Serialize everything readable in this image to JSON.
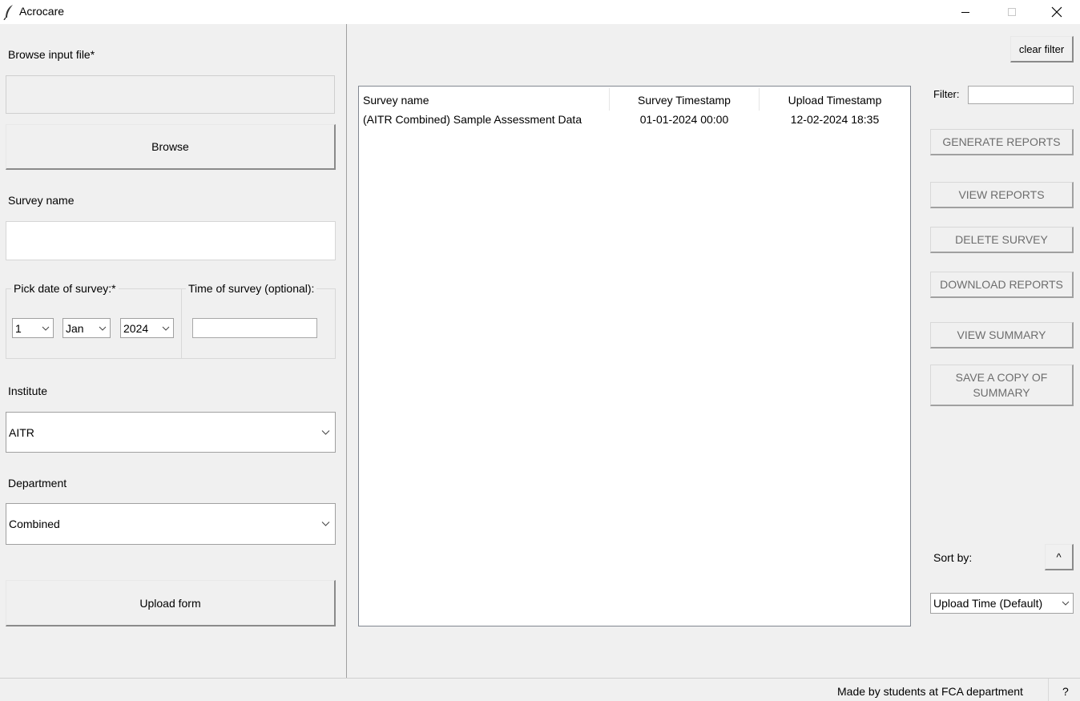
{
  "window": {
    "title": "Acrocare",
    "icon": "feather-icon"
  },
  "upload_panel": {
    "browse_label": "Browse input file*",
    "file_path_value": "",
    "browse_button": "Browse",
    "survey_name_label": "Survey name",
    "survey_name_value": "",
    "date_group_label": "Pick date of survey:*",
    "date_day": "1",
    "date_month": "Jan",
    "date_year": "2024",
    "time_group_label": "Time of survey (optional):",
    "time_value": "",
    "institute_label": "Institute",
    "institute_value": "AITR",
    "department_label": "Department",
    "department_value": "Combined",
    "upload_button": "Upload form"
  },
  "survey_table": {
    "columns": [
      "Survey name",
      "Survey Timestamp",
      "Upload Timestamp"
    ],
    "rows": [
      [
        "(AITR Combined) Sample Assessment Data",
        "01-01-2024 00:00",
        "12-02-2024 18:35"
      ]
    ]
  },
  "actions": {
    "clear_filter": "clear filter",
    "filter_label": "Filter:",
    "filter_value": "",
    "generate_reports": "GENERATE REPORTS",
    "view_reports": "VIEW REPORTS",
    "delete_survey": "DELETE SURVEY",
    "download_reports": "DOWNLOAD REPORTS",
    "view_summary": "VIEW SUMMARY",
    "save_copy_line1": "SAVE A COPY OF",
    "save_copy_line2": "SUMMARY",
    "sort_label": "Sort by:",
    "sort_direction": "^",
    "sort_value": "Upload Time (Default)"
  },
  "status": {
    "credits": "Made by students at FCA department",
    "help": "?"
  }
}
